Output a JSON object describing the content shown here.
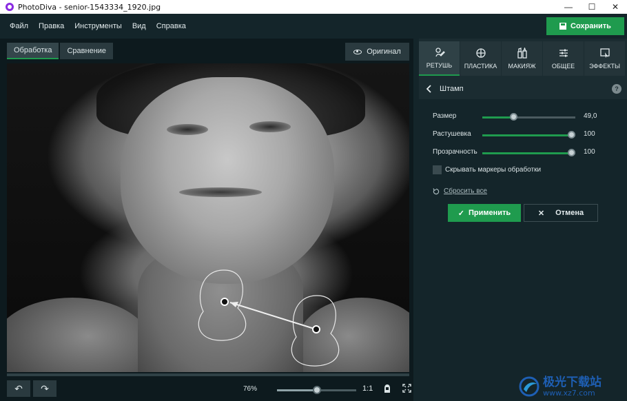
{
  "window": {
    "title": "PhotoDiva - senior-1543334_1920.jpg"
  },
  "menu": [
    "Файл",
    "Правка",
    "Инструменты",
    "Вид",
    "Справка"
  ],
  "header": {
    "save_label": "Сохранить"
  },
  "view_tabs": [
    "Обработка",
    "Сравнение"
  ],
  "original_label": "Оригинал",
  "bottom": {
    "zoom": "76%",
    "zoom_fraction": 0.5,
    "one_to_one": "1:1"
  },
  "tool_tabs": [
    {
      "label": "РЕТУШЬ",
      "icon": "retouch-brush-icon"
    },
    {
      "label": "ПЛАСТИКА",
      "icon": "liquify-icon"
    },
    {
      "label": "МАКИЯЖ",
      "icon": "makeup-icon"
    },
    {
      "label": "ОБЩЕЕ",
      "icon": "adjust-sliders-icon"
    },
    {
      "label": "ЭФФЕКТЫ",
      "icon": "effects-icon"
    }
  ],
  "panel": {
    "title": "Штамп",
    "help": "?",
    "sliders": [
      {
        "label": "Размер",
        "value": "49,0",
        "fraction": 0.34
      },
      {
        "label": "Растушевка",
        "value": "100",
        "fraction": 0.96
      },
      {
        "label": "Прозрачность",
        "value": "100",
        "fraction": 0.96
      }
    ],
    "checkbox_label": "Скрывать маркеры обработки",
    "reset_label": "Сбросить все",
    "apply_label": "Применить",
    "cancel_label": "Отмена"
  },
  "watermark": {
    "cn": "极光下载站",
    "url": "www.xz7.com"
  },
  "colors": {
    "accent": "#1f9b4e",
    "background": "#14252a",
    "panel": "#1b2c31"
  }
}
